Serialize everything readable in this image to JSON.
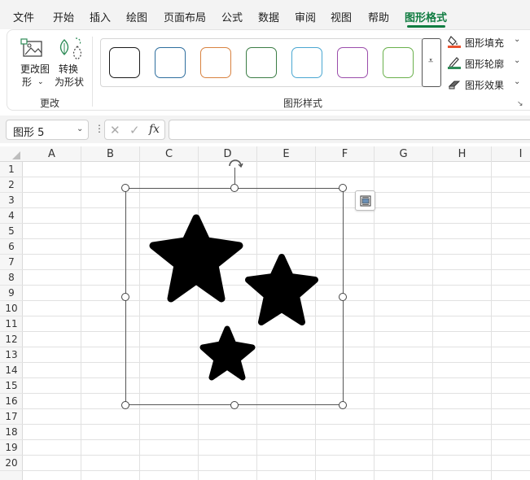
{
  "menu": {
    "items": [
      "文件",
      "开始",
      "插入",
      "绘图",
      "页面布局",
      "公式",
      "数据",
      "审阅",
      "视图",
      "帮助",
      "图形格式"
    ],
    "active": "图形格式"
  },
  "ribbon": {
    "change_shape_label_line1": "更改图",
    "change_shape_label_line2": "形",
    "convert_label_line1": "转换",
    "convert_label_line2": "为形状",
    "change_group_label": "更改",
    "styles_group_label": "图形样式",
    "fill_label": "图形填充",
    "outline_label": "图形轮廓",
    "effects_label": "图形效果",
    "chevron": "⌄",
    "expand_glyph": "⩡",
    "launcher_glyph": "↘",
    "style_colors": [
      "#1a1a1a",
      "#2e6e9e",
      "#d88240",
      "#3b7d45",
      "#4aa7d1",
      "#9b4dab",
      "#6ab04c"
    ],
    "fill_accent": "#e8512e",
    "outline_accent": "#2e8b57"
  },
  "formula_bar": {
    "name_box_value": "图形 5",
    "chevron": "⌄",
    "dots": "⋮",
    "cancel_glyph": "✕",
    "enter_glyph": "✓",
    "fx_label": "fx",
    "formula_value": ""
  },
  "grid": {
    "columns": [
      "A",
      "B",
      "C",
      "D",
      "E",
      "F",
      "G",
      "H",
      "I"
    ],
    "rows": [
      "1",
      "2",
      "3",
      "4",
      "5",
      "6",
      "7",
      "8",
      "9",
      "10",
      "11",
      "12",
      "13",
      "14",
      "15",
      "16",
      "17",
      "18",
      "19",
      "20"
    ]
  },
  "shape": {
    "name": "图形 5",
    "icon": "stars-icon",
    "fill_color": "#000000"
  }
}
